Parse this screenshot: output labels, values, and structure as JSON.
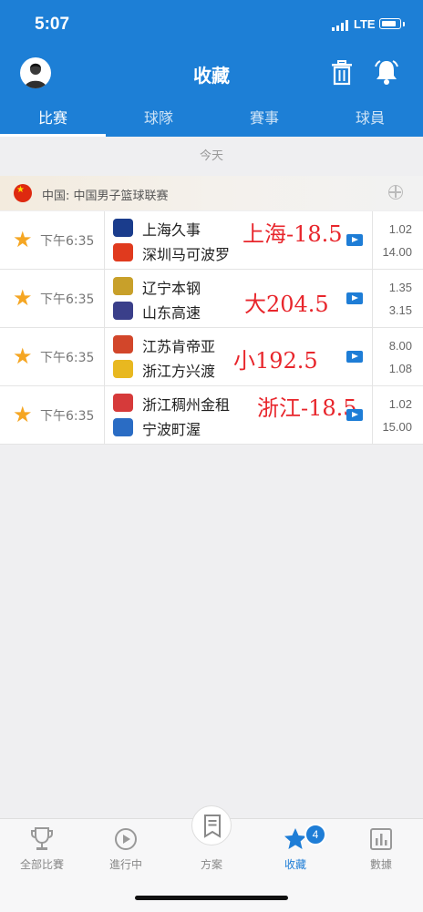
{
  "status_bar": {
    "time": "5:07",
    "network": "LTE"
  },
  "header": {
    "title": "收藏"
  },
  "tabs": [
    {
      "label": "比赛",
      "active": true
    },
    {
      "label": "球隊",
      "active": false
    },
    {
      "label": "賽事",
      "active": false
    },
    {
      "label": "球員",
      "active": false
    }
  ],
  "date_label": "今天",
  "league": {
    "name": "中国: 中国男子篮球联赛"
  },
  "matches": [
    {
      "time": "下午6:35",
      "home": "上海久事",
      "away": "深圳马可波罗",
      "odds_home": "1.02",
      "odds_away": "14.00",
      "handwritten": "上海-18.5",
      "home_logo_color": "#1a3c8c",
      "away_logo_color": "#e03a1e"
    },
    {
      "time": "下午6:35",
      "home": "辽宁本钢",
      "away": "山东高速",
      "odds_home": "1.35",
      "odds_away": "3.15",
      "handwritten": "大204.5",
      "home_logo_color": "#c8a02a",
      "away_logo_color": "#3a3f8a"
    },
    {
      "time": "下午6:35",
      "home": "江苏肯帝亚",
      "away": "浙江方兴渡",
      "odds_home": "8.00",
      "odds_away": "1.08",
      "handwritten": "小192.5",
      "home_logo_color": "#d2462a",
      "away_logo_color": "#e8b820"
    },
    {
      "time": "下午6:35",
      "home": "浙江稠州金租",
      "away": "宁波町渥",
      "odds_home": "1.02",
      "odds_away": "15.00",
      "handwritten": "浙江-18.5",
      "home_logo_color": "#d63a3a",
      "away_logo_color": "#2a6cc4"
    }
  ],
  "tab_bar": [
    {
      "label": "全部比賽",
      "icon": "trophy-icon",
      "active": false
    },
    {
      "label": "進行中",
      "icon": "play-circle-icon",
      "active": false
    },
    {
      "label": "方案",
      "icon": "bookmark-icon",
      "active": false
    },
    {
      "label": "收藏",
      "icon": "star-icon",
      "active": true,
      "badge": "4"
    },
    {
      "label": "數據",
      "icon": "bar-chart-icon",
      "active": false
    }
  ],
  "colors": {
    "primary": "#1d7fd6",
    "star": "#f5a623",
    "annotation": "#e8262c"
  }
}
